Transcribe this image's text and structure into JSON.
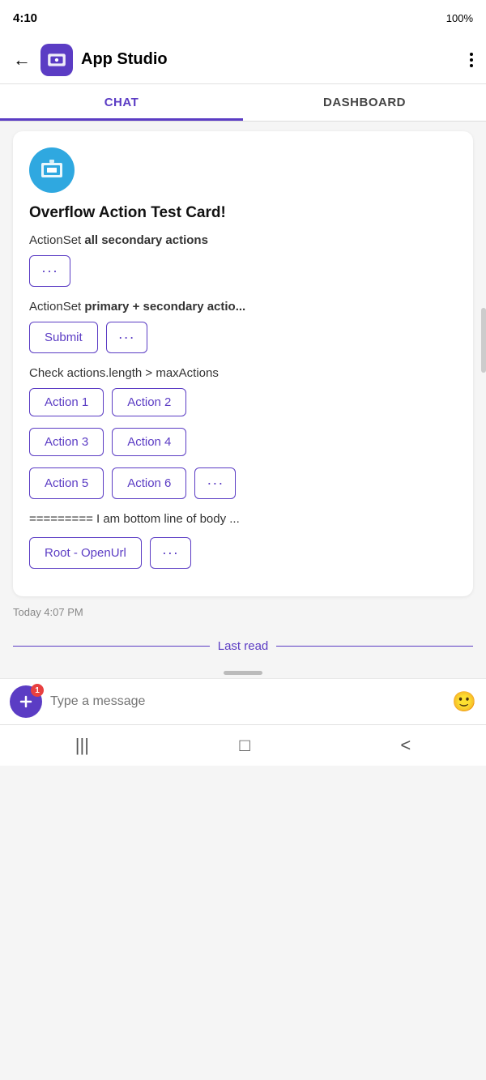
{
  "statusBar": {
    "time": "4:10",
    "battery": "100%"
  },
  "topNav": {
    "backLabel": "←",
    "appName": "App Studio",
    "moreLabel": "⋮"
  },
  "tabs": [
    {
      "id": "chat",
      "label": "CHAT",
      "active": true
    },
    {
      "id": "dashboard",
      "label": "DASHBOARD",
      "active": false
    }
  ],
  "card": {
    "title": "Overflow Action Test Card!",
    "section1": {
      "prefix": "ActionSet ",
      "bold": "all secondary actions"
    },
    "section1Buttons": [
      {
        "label": "···",
        "type": "overflow"
      }
    ],
    "section2": {
      "prefix": "ActionSet ",
      "bold": "primary + secondary actio..."
    },
    "section2Buttons": [
      {
        "label": "Submit",
        "type": "action"
      },
      {
        "label": "···",
        "type": "overflow"
      }
    ],
    "section3Label": "Check actions.length > maxActions",
    "section3Buttons": [
      {
        "label": "Action 1",
        "type": "action"
      },
      {
        "label": "Action 2",
        "type": "action"
      },
      {
        "label": "Action 3",
        "type": "action"
      },
      {
        "label": "Action 4",
        "type": "action"
      },
      {
        "label": "Action 5",
        "type": "action"
      },
      {
        "label": "Action 6",
        "type": "action"
      },
      {
        "label": "···",
        "type": "overflow"
      }
    ],
    "dividerText": "========= I am bottom line of body ...",
    "footerButtons": [
      {
        "label": "Root - OpenUrl",
        "type": "action"
      },
      {
        "label": "···",
        "type": "overflow"
      }
    ]
  },
  "timestamp": "Today 4:07 PM",
  "lastRead": "Last read",
  "inputBar": {
    "placeholder": "Type a message",
    "addBadge": "1"
  },
  "bottomNav": {
    "icons": [
      "|||",
      "□",
      "<"
    ]
  }
}
